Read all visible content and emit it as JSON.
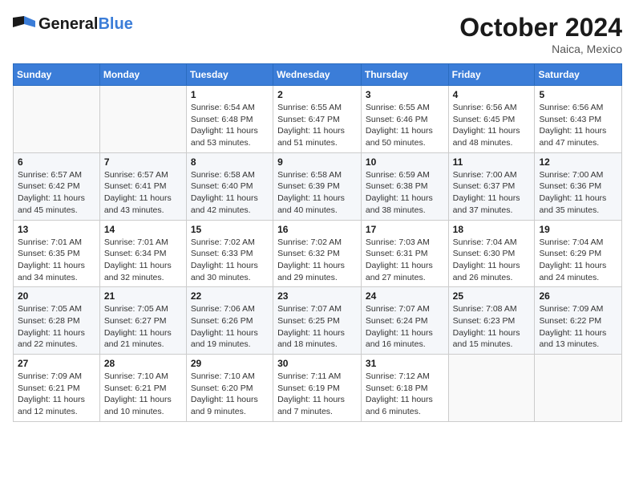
{
  "header": {
    "logo_line1": "General",
    "logo_line2": "Blue",
    "month": "October 2024",
    "location": "Naica, Mexico"
  },
  "weekdays": [
    "Sunday",
    "Monday",
    "Tuesday",
    "Wednesday",
    "Thursday",
    "Friday",
    "Saturday"
  ],
  "weeks": [
    [
      {
        "day": "",
        "info": ""
      },
      {
        "day": "",
        "info": ""
      },
      {
        "day": "1",
        "info": "Sunrise: 6:54 AM\nSunset: 6:48 PM\nDaylight: 11 hours and 53 minutes."
      },
      {
        "day": "2",
        "info": "Sunrise: 6:55 AM\nSunset: 6:47 PM\nDaylight: 11 hours and 51 minutes."
      },
      {
        "day": "3",
        "info": "Sunrise: 6:55 AM\nSunset: 6:46 PM\nDaylight: 11 hours and 50 minutes."
      },
      {
        "day": "4",
        "info": "Sunrise: 6:56 AM\nSunset: 6:45 PM\nDaylight: 11 hours and 48 minutes."
      },
      {
        "day": "5",
        "info": "Sunrise: 6:56 AM\nSunset: 6:43 PM\nDaylight: 11 hours and 47 minutes."
      }
    ],
    [
      {
        "day": "6",
        "info": "Sunrise: 6:57 AM\nSunset: 6:42 PM\nDaylight: 11 hours and 45 minutes."
      },
      {
        "day": "7",
        "info": "Sunrise: 6:57 AM\nSunset: 6:41 PM\nDaylight: 11 hours and 43 minutes."
      },
      {
        "day": "8",
        "info": "Sunrise: 6:58 AM\nSunset: 6:40 PM\nDaylight: 11 hours and 42 minutes."
      },
      {
        "day": "9",
        "info": "Sunrise: 6:58 AM\nSunset: 6:39 PM\nDaylight: 11 hours and 40 minutes."
      },
      {
        "day": "10",
        "info": "Sunrise: 6:59 AM\nSunset: 6:38 PM\nDaylight: 11 hours and 38 minutes."
      },
      {
        "day": "11",
        "info": "Sunrise: 7:00 AM\nSunset: 6:37 PM\nDaylight: 11 hours and 37 minutes."
      },
      {
        "day": "12",
        "info": "Sunrise: 7:00 AM\nSunset: 6:36 PM\nDaylight: 11 hours and 35 minutes."
      }
    ],
    [
      {
        "day": "13",
        "info": "Sunrise: 7:01 AM\nSunset: 6:35 PM\nDaylight: 11 hours and 34 minutes."
      },
      {
        "day": "14",
        "info": "Sunrise: 7:01 AM\nSunset: 6:34 PM\nDaylight: 11 hours and 32 minutes."
      },
      {
        "day": "15",
        "info": "Sunrise: 7:02 AM\nSunset: 6:33 PM\nDaylight: 11 hours and 30 minutes."
      },
      {
        "day": "16",
        "info": "Sunrise: 7:02 AM\nSunset: 6:32 PM\nDaylight: 11 hours and 29 minutes."
      },
      {
        "day": "17",
        "info": "Sunrise: 7:03 AM\nSunset: 6:31 PM\nDaylight: 11 hours and 27 minutes."
      },
      {
        "day": "18",
        "info": "Sunrise: 7:04 AM\nSunset: 6:30 PM\nDaylight: 11 hours and 26 minutes."
      },
      {
        "day": "19",
        "info": "Sunrise: 7:04 AM\nSunset: 6:29 PM\nDaylight: 11 hours and 24 minutes."
      }
    ],
    [
      {
        "day": "20",
        "info": "Sunrise: 7:05 AM\nSunset: 6:28 PM\nDaylight: 11 hours and 22 minutes."
      },
      {
        "day": "21",
        "info": "Sunrise: 7:05 AM\nSunset: 6:27 PM\nDaylight: 11 hours and 21 minutes."
      },
      {
        "day": "22",
        "info": "Sunrise: 7:06 AM\nSunset: 6:26 PM\nDaylight: 11 hours and 19 minutes."
      },
      {
        "day": "23",
        "info": "Sunrise: 7:07 AM\nSunset: 6:25 PM\nDaylight: 11 hours and 18 minutes."
      },
      {
        "day": "24",
        "info": "Sunrise: 7:07 AM\nSunset: 6:24 PM\nDaylight: 11 hours and 16 minutes."
      },
      {
        "day": "25",
        "info": "Sunrise: 7:08 AM\nSunset: 6:23 PM\nDaylight: 11 hours and 15 minutes."
      },
      {
        "day": "26",
        "info": "Sunrise: 7:09 AM\nSunset: 6:22 PM\nDaylight: 11 hours and 13 minutes."
      }
    ],
    [
      {
        "day": "27",
        "info": "Sunrise: 7:09 AM\nSunset: 6:21 PM\nDaylight: 11 hours and 12 minutes."
      },
      {
        "day": "28",
        "info": "Sunrise: 7:10 AM\nSunset: 6:21 PM\nDaylight: 11 hours and 10 minutes."
      },
      {
        "day": "29",
        "info": "Sunrise: 7:10 AM\nSunset: 6:20 PM\nDaylight: 11 hours and 9 minutes."
      },
      {
        "day": "30",
        "info": "Sunrise: 7:11 AM\nSunset: 6:19 PM\nDaylight: 11 hours and 7 minutes."
      },
      {
        "day": "31",
        "info": "Sunrise: 7:12 AM\nSunset: 6:18 PM\nDaylight: 11 hours and 6 minutes."
      },
      {
        "day": "",
        "info": ""
      },
      {
        "day": "",
        "info": ""
      }
    ]
  ]
}
